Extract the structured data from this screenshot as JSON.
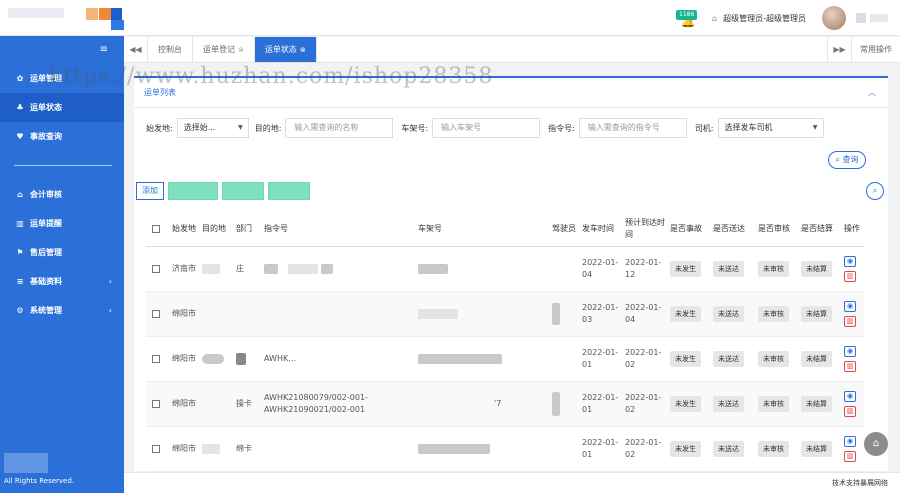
{
  "header": {
    "notification_count": "1186",
    "user_text": "超级管理员-超级管理员",
    "home_icon": "home-icon",
    "bell_icon": "bell-icon"
  },
  "sidebar": {
    "items": [
      {
        "label": "运单管理",
        "icon": "paw-icon",
        "glyph": "✿"
      },
      {
        "label": "运单状态",
        "icon": "sitemap-icon",
        "glyph": "♣"
      },
      {
        "label": "事故查询",
        "icon": "heart-icon",
        "glyph": "♥"
      },
      {
        "label": "会计审核",
        "icon": "bank-icon",
        "glyph": "⌂"
      },
      {
        "label": "运单提醒",
        "icon": "chart-icon",
        "glyph": "▥"
      },
      {
        "label": "售后管理",
        "icon": "tag-icon",
        "glyph": "⚑"
      },
      {
        "label": "基础资料",
        "icon": "list-icon",
        "glyph": "≡"
      },
      {
        "label": "系统管理",
        "icon": "gear-icon",
        "glyph": "⚙"
      }
    ],
    "copyright": "All Rights Reserved."
  },
  "tabs": {
    "items": [
      {
        "label": "控制台",
        "closable": false
      },
      {
        "label": "运单登记",
        "closable": true
      },
      {
        "label": "运单状态",
        "closable": true
      }
    ],
    "common_ops": "常用操作"
  },
  "watermark": "https://www.huzhan.com/ishop28358",
  "panel": {
    "title": "运单列表",
    "filters": {
      "origin_label": "始发地:",
      "origin_value": "选择始...",
      "dest_label": "目的地:",
      "dest_placeholder": "输入需查询的名称",
      "frame_label": "车架号:",
      "frame_placeholder": "输入车架号",
      "cmd_label": "指令号:",
      "cmd_placeholder": "输入需查询的指令号",
      "driver_label": "司机:",
      "driver_value": "选择发车司机"
    },
    "query_button": "查询",
    "add_button": "添加"
  },
  "table": {
    "headers": {
      "from": "始发地",
      "to": "目的地",
      "dept": "部门",
      "cmd": "指令号",
      "frame": "车架号",
      "driver": "驾驶员",
      "depart": "发车时间",
      "arrive": "预计到达时间",
      "accident": "是否事故",
      "delivered": "是否送达",
      "audited": "是否审核",
      "settled": "是否结算",
      "op": "操作"
    },
    "rows": [
      {
        "from": "济南市",
        "dept": "庄",
        "cmd": "",
        "frame": "",
        "depart": "2022-01-04",
        "arrive": "2022-01-12",
        "accident": "未发生",
        "delivered": "未送达",
        "audited": "未审核",
        "settled": "未结算"
      },
      {
        "from": "绵阳市",
        "dept": "",
        "cmd": "",
        "frame": "",
        "depart": "2022-01-03",
        "arrive": "2022-01-04",
        "accident": "未发生",
        "delivered": "未送达",
        "audited": "未审核",
        "settled": "未结算"
      },
      {
        "from": "绵阳市",
        "dept": "",
        "cmd": "AWHK…",
        "frame": "",
        "depart": "2022-01-01",
        "arrive": "2022-01-02",
        "accident": "未发生",
        "delivered": "未送达",
        "audited": "未审核",
        "settled": "未结算"
      },
      {
        "from": "绵阳市",
        "dept": "操卡",
        "cmd": "AWHK21080079/002-001-AWHK21090021/002-001",
        "frame": "'7",
        "depart": "2022-01-01",
        "arrive": "2022-01-02",
        "accident": "未发生",
        "delivered": "未送达",
        "audited": "未审核",
        "settled": "未结算"
      },
      {
        "from": "绵阳市",
        "dept": "绵卡",
        "cmd": "",
        "frame": "",
        "depart": "2022-01-01",
        "arrive": "2022-01-02",
        "accident": "未发生",
        "delivered": "未送达",
        "audited": "未审核",
        "settled": "未结算"
      }
    ]
  },
  "footer": {
    "text": "技术支持暴展网络"
  }
}
